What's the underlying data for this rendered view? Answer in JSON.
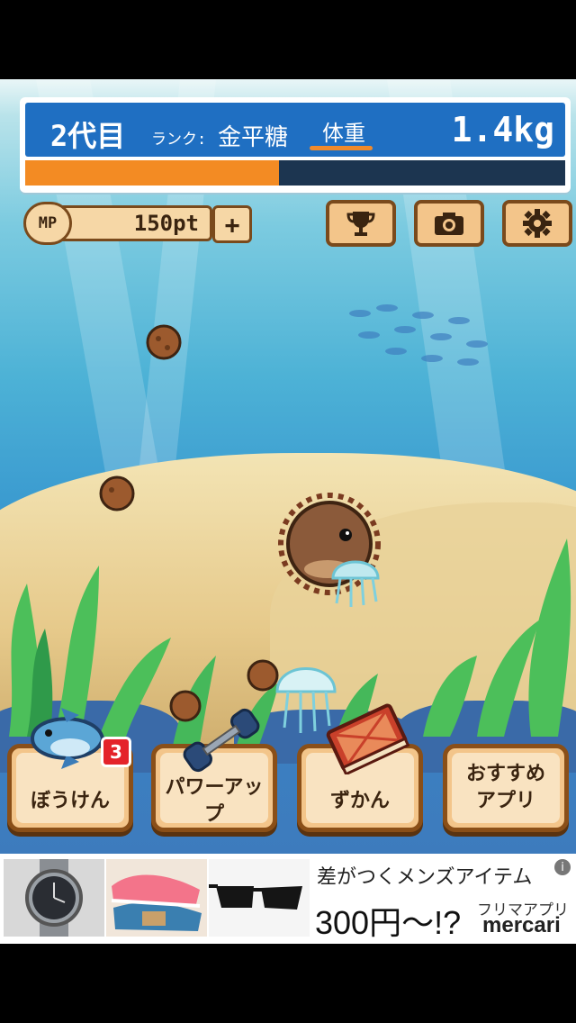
{
  "status": {
    "generation": "2代目",
    "rank_label": "ランク:",
    "rank_value": "金平糖",
    "weight_label": "体重",
    "weight_value": "1.4kg",
    "growth_progress": 0.47
  },
  "points": {
    "mp_label": "MP",
    "mp_value": "150pt",
    "add_symbol": "+"
  },
  "toolbar": {
    "trophy_icon": "trophy-icon",
    "camera_icon": "camera-icon",
    "settings_icon": "gear-icon"
  },
  "menu": [
    {
      "label": "ぼうけん",
      "badge": "3"
    },
    {
      "label": "パワーアップ"
    },
    {
      "label": "ずかん"
    },
    {
      "label": "おすすめ\nアプリ"
    }
  ],
  "ad": {
    "headline": "差がつくメンズアイテム",
    "price": "300円〜!?",
    "sub": "フリマアプリ",
    "brand": "mercari",
    "info": "i"
  },
  "colors": {
    "panel_blue": "#1f6fc2",
    "progress_orange": "#f38b23",
    "button_fill": "#f3c58a",
    "button_border": "#7a4a1c",
    "badge_red": "#e4232a"
  }
}
